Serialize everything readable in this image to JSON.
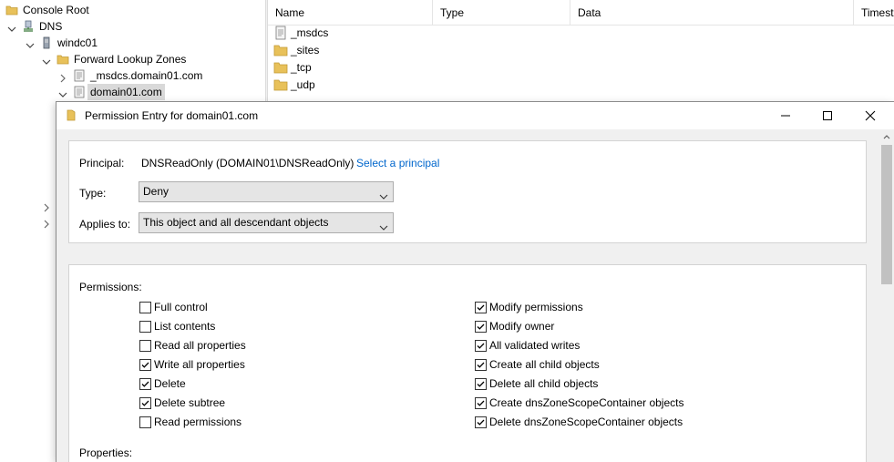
{
  "tree": {
    "items": [
      {
        "label": "Console Root",
        "icon": "folder-icon"
      },
      {
        "label": "DNS",
        "icon": "dns-server-icon"
      },
      {
        "label": "windc01",
        "icon": "server-icon"
      },
      {
        "label": "Forward Lookup Zones",
        "icon": "folder-icon"
      },
      {
        "label": "_msdcs.domain01.com",
        "icon": "zone-icon"
      },
      {
        "label": "domain01.com",
        "icon": "zone-icon"
      }
    ]
  },
  "list": {
    "columns": [
      "Name",
      "Type",
      "Data",
      "Timest"
    ],
    "items": [
      {
        "label": "_msdcs",
        "icon": "zone-folder-icon"
      },
      {
        "label": "_sites",
        "icon": "folder-icon"
      },
      {
        "label": "_tcp",
        "icon": "folder-icon"
      },
      {
        "label": "_udp",
        "icon": "folder-icon"
      }
    ]
  },
  "dialog": {
    "title": "Permission Entry for domain01.com",
    "principal": {
      "label": "Principal:",
      "value": "DNSReadOnly (DOMAIN01\\DNSReadOnly)",
      "link": "Select a principal"
    },
    "type": {
      "label": "Type:",
      "value": "Deny"
    },
    "applies_to": {
      "label": "Applies to:",
      "value": "This object and all descendant objects"
    },
    "permissions_label": "Permissions:",
    "permissions_left": [
      {
        "label": "Full control",
        "checked": false
      },
      {
        "label": "List contents",
        "checked": false
      },
      {
        "label": "Read all properties",
        "checked": false
      },
      {
        "label": "Write all properties",
        "checked": true
      },
      {
        "label": "Delete",
        "checked": true
      },
      {
        "label": "Delete subtree",
        "checked": true
      },
      {
        "label": "Read permissions",
        "checked": false
      }
    ],
    "permissions_right": [
      {
        "label": "Modify permissions",
        "checked": true
      },
      {
        "label": "Modify owner",
        "checked": true
      },
      {
        "label": "All validated writes",
        "checked": true
      },
      {
        "label": "Create all child objects",
        "checked": true
      },
      {
        "label": "Delete all child objects",
        "checked": true
      },
      {
        "label": "Create dnsZoneScopeContainer objects",
        "checked": true
      },
      {
        "label": "Delete dnsZoneScopeContainer objects",
        "checked": true
      }
    ],
    "properties_label": "Properties:"
  },
  "colors": {
    "link": "#0066cc",
    "folder": "#e8c15a",
    "content_bg": "#f0f0f0"
  }
}
